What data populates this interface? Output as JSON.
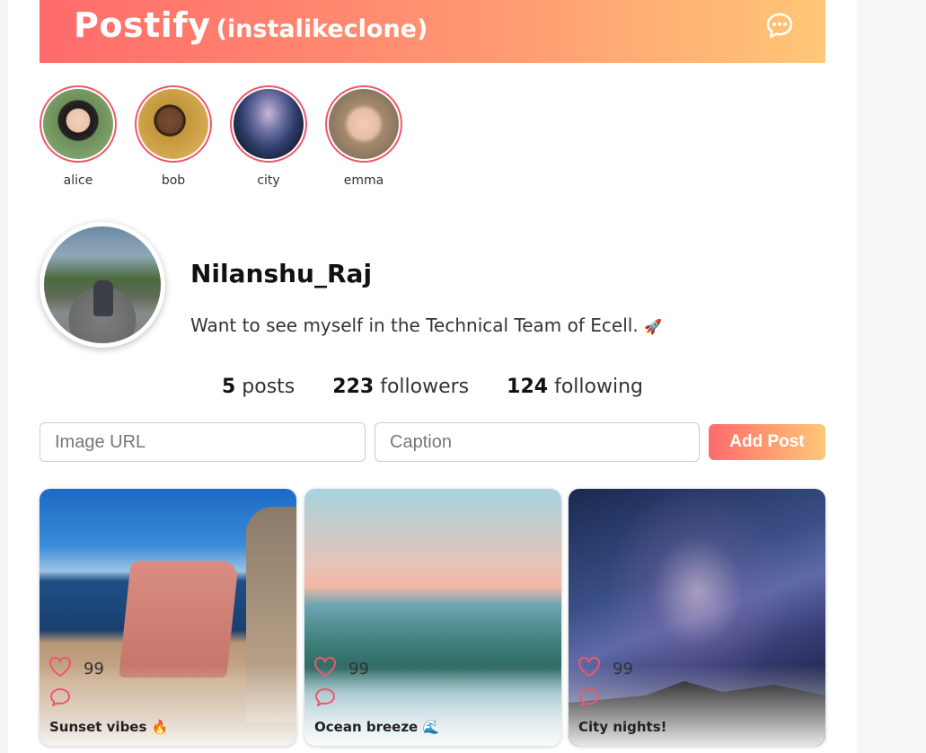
{
  "app": {
    "name": "Postify",
    "subtitle": "(instalikeclone)"
  },
  "stories": [
    {
      "label": "alice",
      "color": "#6b8f5e"
    },
    {
      "label": "bob",
      "color": "#c4963a"
    },
    {
      "label": "city",
      "color": "#2f3d6c"
    },
    {
      "label": "emma",
      "color": "#8a7760"
    }
  ],
  "profile": {
    "username": "Nilanshu_Raj",
    "bio": "Want to see myself in the Technical Team of Ecell.",
    "bio_emoji": "🚀",
    "stats": {
      "posts_count": "5",
      "posts_label": "posts",
      "followers_count": "223",
      "followers_label": "followers",
      "following_count": "124",
      "following_label": "following"
    }
  },
  "form": {
    "url_placeholder": "Image URL",
    "caption_placeholder": "Caption",
    "add_label": "Add Post"
  },
  "posts": [
    {
      "likes": "99",
      "caption": "Sunset vibes 🔥"
    },
    {
      "likes": "99",
      "caption": "Ocean breeze 🌊"
    },
    {
      "likes": "99",
      "caption": "City nights!"
    }
  ],
  "colors": {
    "accent": "#ff6b6b",
    "accent_end": "#ffc777",
    "story_ring": "#f0566a"
  }
}
